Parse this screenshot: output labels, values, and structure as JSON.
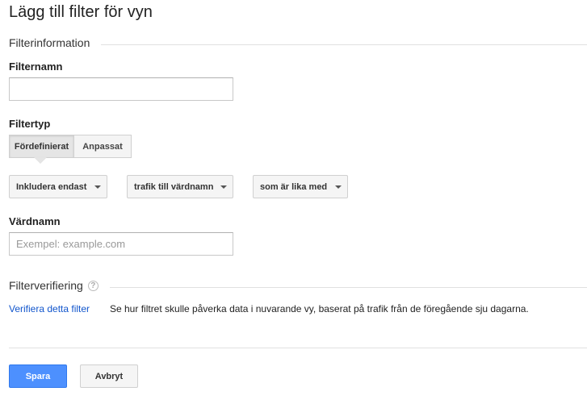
{
  "page": {
    "title": "Lägg till filter för vyn"
  },
  "filter_info": {
    "section_title": "Filterinformation",
    "name_label": "Filternamn",
    "name_value": "",
    "type_label": "Filtertyp",
    "type_tabs": [
      {
        "label": "Fördefinierat",
        "active": true
      },
      {
        "label": "Anpassat",
        "active": false
      }
    ],
    "dropdowns": {
      "include": "Inkludera endast",
      "traffic": "trafik till värdnamn",
      "operator": "som är lika med"
    },
    "hostname_label": "Värdnamn",
    "hostname_placeholder": "Exempel: example.com"
  },
  "verification": {
    "section_title": "Filterverifiering",
    "help_glyph": "?",
    "link_label": "Verifiera detta filter",
    "description": "Se hur filtret skulle påverka data i nuvarande vy, baserat på trafik från de föregående sju dagarna."
  },
  "actions": {
    "save_label": "Spara",
    "cancel_label": "Avbryt"
  },
  "colors": {
    "primary": "#4d90fe",
    "link": "#1155cc"
  }
}
